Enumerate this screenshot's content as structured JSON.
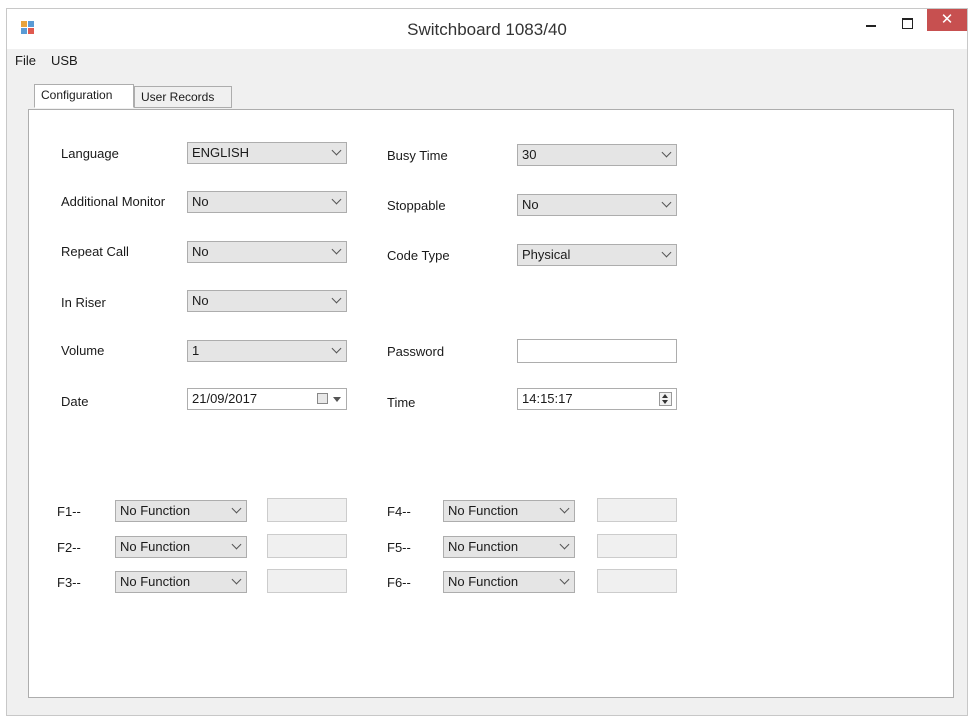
{
  "window": {
    "title": "Switchboard 1083/40",
    "close_glyph": "✕"
  },
  "menu": {
    "file": "File",
    "usb": "USB"
  },
  "tabs": {
    "configuration": "Configuration",
    "user_records": "User Records"
  },
  "config": {
    "language": {
      "label": "Language",
      "value": "ENGLISH"
    },
    "additional_monitor": {
      "label": "Additional Monitor",
      "value": "No"
    },
    "repeat_call": {
      "label": "Repeat Call",
      "value": "No"
    },
    "in_riser": {
      "label": "In Riser",
      "value": "No"
    },
    "volume": {
      "label": "Volume",
      "value": "1"
    },
    "date": {
      "label": "Date",
      "value": "21/09/2017"
    },
    "busy_time": {
      "label": "Busy Time",
      "value": "30"
    },
    "stoppable": {
      "label": "Stoppable",
      "value": "No"
    },
    "code_type": {
      "label": "Code Type",
      "value": "Physical"
    },
    "password": {
      "label": "Password",
      "value": ""
    },
    "time": {
      "label": "Time",
      "value": "14:15:17"
    }
  },
  "functions": [
    {
      "label": "F1--",
      "value": "No Function",
      "extra": ""
    },
    {
      "label": "F2--",
      "value": "No Function",
      "extra": ""
    },
    {
      "label": "F3--",
      "value": "No Function",
      "extra": ""
    },
    {
      "label": "F4--",
      "value": "No Function",
      "extra": ""
    },
    {
      "label": "F5--",
      "value": "No Function",
      "extra": ""
    },
    {
      "label": "F6--",
      "value": "No Function",
      "extra": ""
    }
  ],
  "colors": {
    "close_button": "#c75050",
    "window_bg": "#f0f0f0",
    "panel_bg": "#ffffff",
    "border": "#adadad"
  }
}
